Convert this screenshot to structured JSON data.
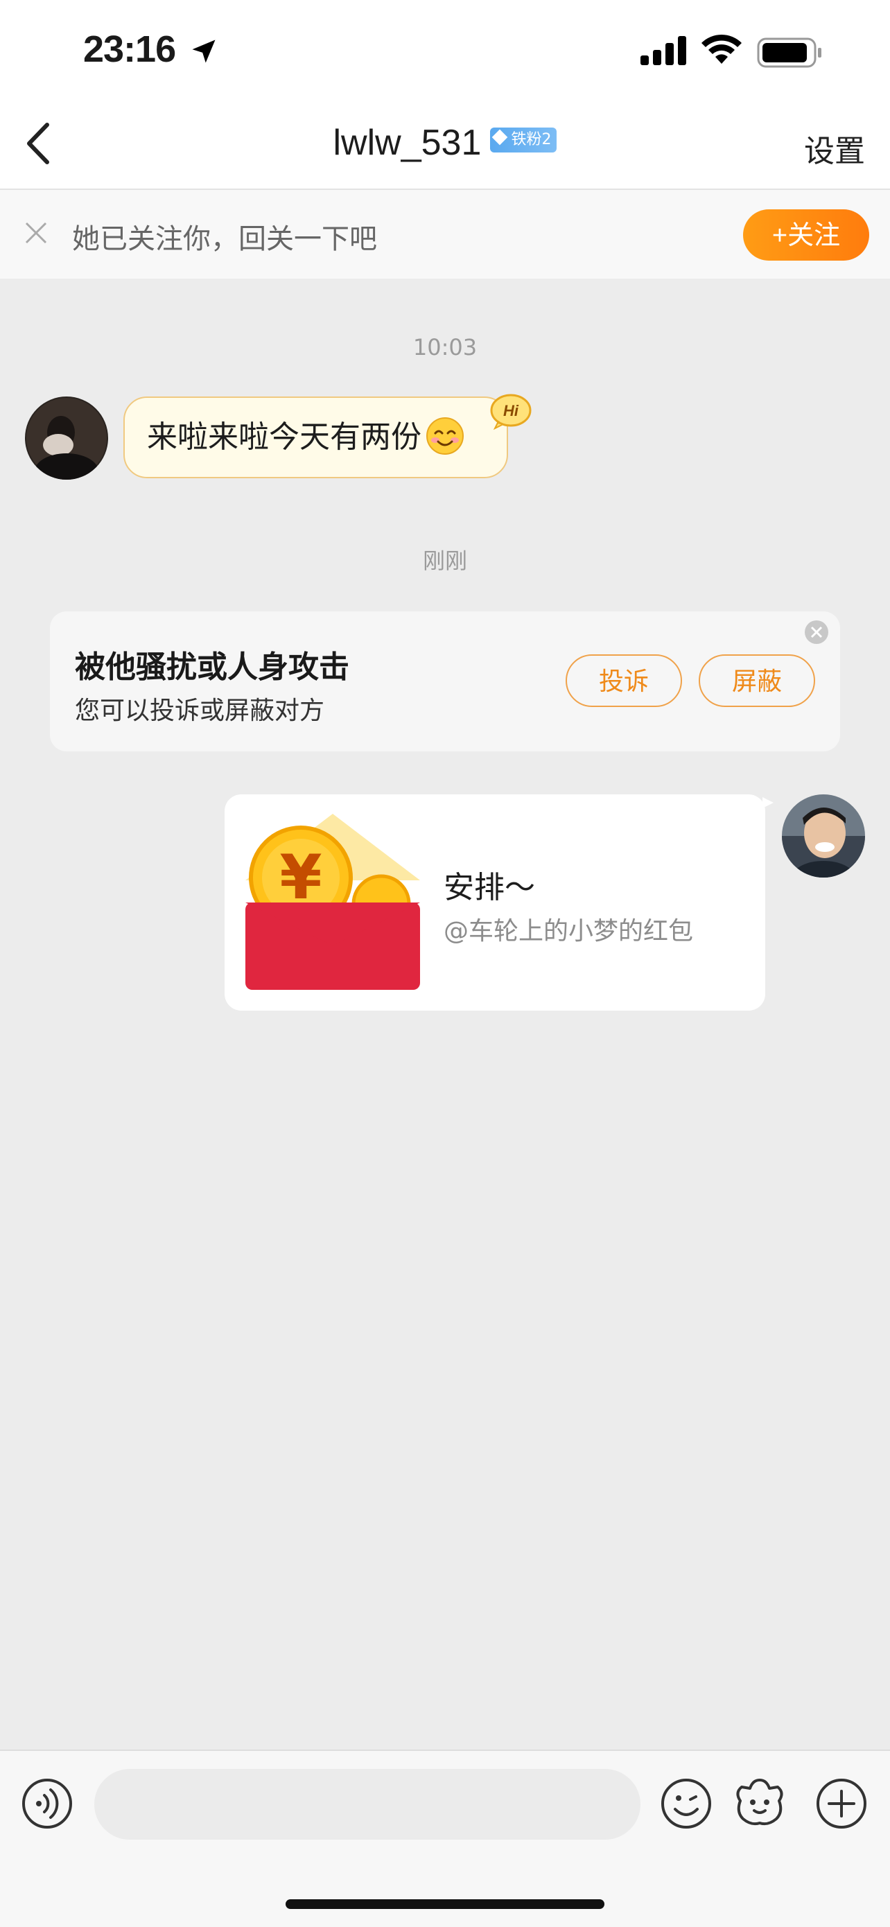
{
  "status_bar": {
    "time": "23:16"
  },
  "nav": {
    "title": "lwlw_531",
    "badge": "铁粉2",
    "settings_label": "设置"
  },
  "follow_prompt": {
    "text": "她已关注你，回关一下吧",
    "button_label": "+关注"
  },
  "messages": [
    {
      "type": "timestamp",
      "text": "10:03"
    },
    {
      "type": "incoming_text",
      "text": "来啦来啦今天有两份",
      "decoration": "Hi"
    },
    {
      "type": "timestamp",
      "text": "刚刚"
    }
  ],
  "harass_card": {
    "title": "被他骚扰或人身攻击",
    "subtitle": "您可以投诉或屏蔽对方",
    "complain_label": "投诉",
    "block_label": "屏蔽"
  },
  "red_packet": {
    "title": "安排～",
    "subtitle": "@车轮上的小梦的红包"
  },
  "input_bar": {
    "placeholder": ""
  },
  "colors": {
    "accent_orange": "#ff8a12",
    "packet_red": "#e0263f",
    "bubble_border": "#f0c980",
    "badge_blue": "#5aa9ef"
  },
  "icons": [
    "location-arrow-icon",
    "signal-icon",
    "wifi-icon",
    "battery-icon",
    "back-icon",
    "close-icon",
    "voice-icon",
    "emoji-icon",
    "sticker-icon",
    "plus-icon"
  ]
}
